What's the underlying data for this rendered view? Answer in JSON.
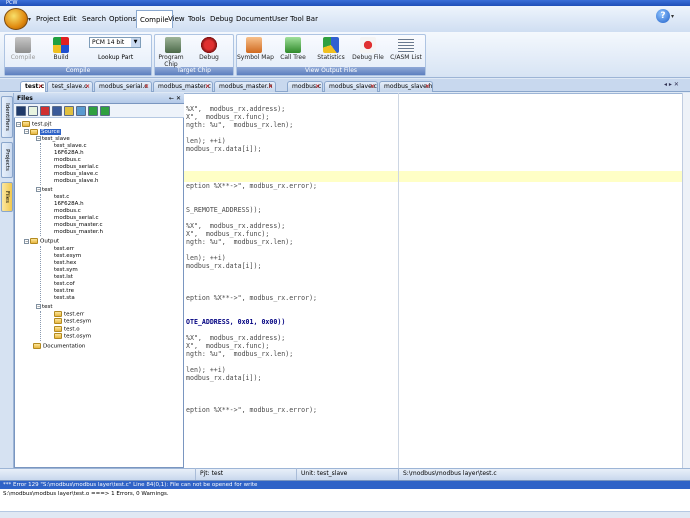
{
  "window": {
    "title": "PCW"
  },
  "menu": {
    "items": [
      "Project",
      "Edit",
      "Search",
      "Options",
      "Compile",
      "View",
      "Tools",
      "Debug",
      "Document",
      "User Tool Bar"
    ]
  },
  "ribbon": {
    "compile_group": {
      "label": "Compile",
      "compile_btn": "Compile",
      "build_btn": "Build",
      "part_value": "PCM 14 bit",
      "lookup_part": "Lookup Part"
    },
    "target_group": {
      "label": "Target Chip",
      "program_chip": "Program Chip",
      "debug": "Debug"
    },
    "output_group": {
      "label": "View Output Files",
      "symbol_map": "Symbol Map",
      "call_tree": "Call Tree",
      "statistics": "Statistics",
      "debug_file": "Debug File",
      "casm_list": "C/ASM List"
    }
  },
  "tabs": [
    "test.c",
    "test_slave.c",
    "modbus_serial.c",
    "modbus_master.c",
    "modbus_master.h",
    "modbus.c",
    "modbus_slave.c",
    "modbus_slave.h"
  ],
  "sidetabs": {
    "identifiers": "Identifiers",
    "projects": "Projects",
    "files": "Files"
  },
  "files_panel": {
    "title": "Files",
    "controls": "← ✕",
    "tree": {
      "root": "test.pjt",
      "source": "Source",
      "test_slave": "test_slave",
      "test_slave_files": [
        "test_slave.c",
        "16F628A.h",
        "modbus.c",
        "modbus_serial.c",
        "modbus_slave.c",
        "modbus_slave.h"
      ],
      "test": "test",
      "test_files": [
        "test.c",
        "16F628A.h",
        "modbus.c",
        "modbus_serial.c",
        "modbus_master.c",
        "modbus_master.h"
      ],
      "output": "Output",
      "output_files": [
        "test.err",
        "test.esym",
        "test.hex",
        "test.sym",
        "test.lst",
        "test.cof",
        "test.tre",
        "test.sta"
      ],
      "output_test": "test",
      "output_test_files": [
        "test.err",
        "test.esym",
        "test.o",
        "test.osym"
      ],
      "documentation": "Documentation"
    }
  },
  "editor": {
    "lines": [
      {
        "text": "%X\",  modbus_rx.address);"
      },
      {
        "text": "X\",  modbus_rx.func);"
      },
      {
        "text": "ngth: %u\",  modbus_rx.len);"
      },
      {
        "text": ""
      },
      {
        "text": "len); ++i)"
      },
      {
        "text": "modbus_rx.data[i]);"
      },
      {
        "text": ""
      },
      {
        "text": ""
      },
      {
        "text": "eption %X**->\", modbus_rx.error);"
      },
      {
        "text": ""
      },
      {
        "text": ""
      },
      {
        "text": "S_REMOTE_ADDRESS));"
      },
      {
        "text": ""
      },
      {
        "text": "%X\",  modbus_rx.address);"
      },
      {
        "text": "X\",  modbus_rx.func);"
      },
      {
        "text": "ngth: %u\",  modbus_rx.len);"
      },
      {
        "text": ""
      },
      {
        "text": "len); ++i)"
      },
      {
        "text": "modbus_rx.data[i]);"
      },
      {
        "text": ""
      },
      {
        "text": ""
      },
      {
        "text": ""
      },
      {
        "text": "eption %X**->\", modbus_rx.error);"
      },
      {
        "text": ""
      },
      {
        "text": ""
      },
      {
        "text": "OTE_ADDRESS, 0x01, 0x00))"
      },
      {
        "text": ""
      },
      {
        "text": "%X\",  modbus_rx.address);"
      },
      {
        "text": "X\",  modbus_rx.func);"
      },
      {
        "text": "ngth: %u\",  modbus_rx.len);"
      },
      {
        "text": ""
      },
      {
        "text": "len); ++i)"
      },
      {
        "text": "modbus_rx.data[i]);"
      },
      {
        "text": ""
      },
      {
        "text": ""
      },
      {
        "text": ""
      },
      {
        "text": "eption %X**->\", modbus_rx.error);"
      }
    ]
  },
  "status": {
    "pjt": "Pjt: test",
    "unit": "Unit: test_slave",
    "path": "S:\\modbus\\modbus layer\\test.c"
  },
  "output": {
    "error_line": "*** Error 129 \"S:\\modbus\\modbus layer\\test.c\" Line 84(0,1): File can not be opened for write",
    "summary_line": "S:\\modbus\\modbus layer\\test.o ===>  1 Errors,  0 Warnings."
  }
}
